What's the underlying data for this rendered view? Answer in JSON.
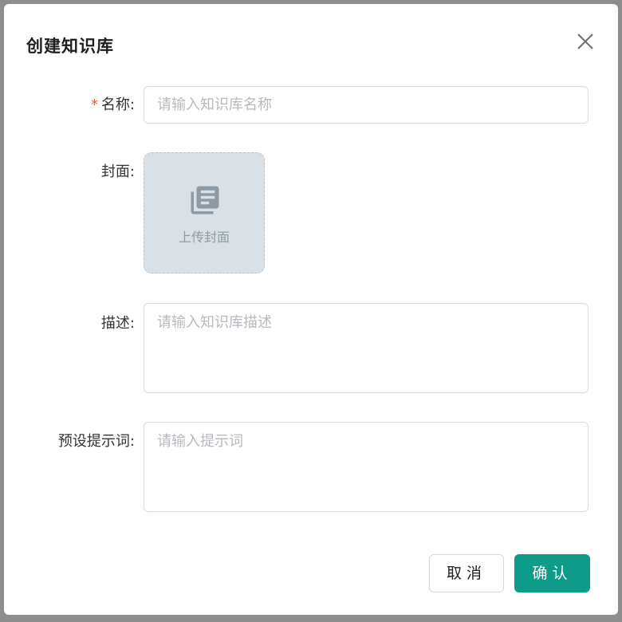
{
  "dialog": {
    "title": "创建知识库",
    "close_icon": "close-icon"
  },
  "form": {
    "name": {
      "required_mark": "*",
      "label": "名称:",
      "placeholder": "请输入知识库名称",
      "value": ""
    },
    "cover": {
      "label": "封面:",
      "upload_text": "上传封面",
      "icon": "library-books-icon"
    },
    "description": {
      "label": "描述:",
      "placeholder": "请输入知识库描述",
      "value": ""
    },
    "prompt": {
      "label": "预设提示词:",
      "placeholder": "请输入提示词",
      "value": ""
    }
  },
  "footer": {
    "cancel_label": "取消",
    "confirm_label": "确认"
  },
  "colors": {
    "accent": "#0e9b8a",
    "required": "#e05a4e",
    "upload_bg": "#d9e1e7"
  }
}
